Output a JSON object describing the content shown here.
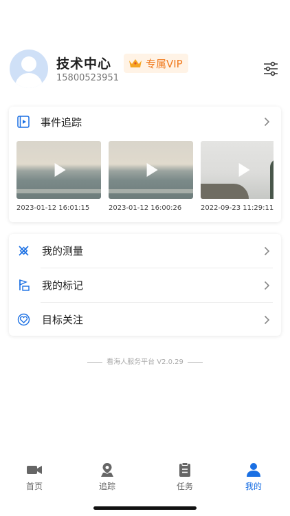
{
  "profile": {
    "name": "技术中心",
    "phone": "15800523951",
    "vip_label": "专属VIP"
  },
  "tracking": {
    "title": "事件追踪",
    "videos": [
      {
        "timestamp": "2023-01-12 16:01:15"
      },
      {
        "timestamp": "2023-01-12 16:00:26"
      },
      {
        "timestamp": "2022-09-23 11:29:11"
      }
    ]
  },
  "menu": {
    "items": [
      {
        "label": "我的测量",
        "icon": "measure-icon"
      },
      {
        "label": "我的标记",
        "icon": "flag-icon"
      },
      {
        "label": "目标关注",
        "icon": "heart-icon"
      }
    ]
  },
  "footer": {
    "text": "看海人服务平台 V2.0.29"
  },
  "tabbar": {
    "tabs": [
      {
        "label": "首页",
        "icon": "video-camera-icon"
      },
      {
        "label": "追踪",
        "icon": "location-pin-icon"
      },
      {
        "label": "任务",
        "icon": "clipboard-icon"
      },
      {
        "label": "我的",
        "icon": "user-icon",
        "active": true
      }
    ]
  },
  "colors": {
    "accent": "#1a6fe3",
    "vip_orange": "#f07a1e",
    "icon_gray": "#666666"
  }
}
